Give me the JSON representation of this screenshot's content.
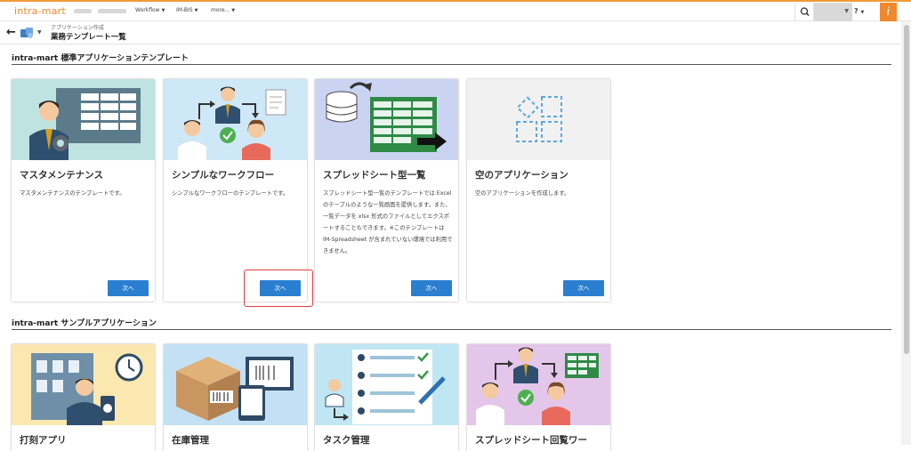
{
  "header": {
    "logo": "intra-mart",
    "nav": [
      "Workflow",
      "IM-BIS",
      "more..."
    ],
    "help_label": "?",
    "info_label": "i"
  },
  "breadcrumb": {
    "parent": "アプリケーション作成",
    "title": "業務テンプレート一覧"
  },
  "sections": [
    {
      "title": "intra-mart 標準アプリケーションテンプレート",
      "cards": [
        {
          "title": "マスタメンテナンス",
          "desc": "マスタメンテナンスのテンプレートです。",
          "button": "次へ",
          "image": "master-maintenance-illustration"
        },
        {
          "title": "シンプルなワークフロー",
          "desc": "シンプルなワークフローのテンプレートです。",
          "button": "次へ",
          "image": "simple-workflow-illustration"
        },
        {
          "title": "スプレッドシート型一覧",
          "desc": "スプレッドシート型一覧のテンプレートでは Excel のテーブルのような一覧画面を提供します。また、一覧データを xlsx 形式のファイルとしてエクスポートすることもできます。※このテンプレートは IM-Spreadsheet が含まれていない環境では利用できません。",
          "button": "次へ",
          "image": "spreadsheet-list-illustration"
        },
        {
          "title": "空のアプリケーション",
          "desc": "空のアプリケーションを作成します。",
          "button": "次へ",
          "image": "empty-application-illustration"
        }
      ]
    },
    {
      "title": "intra-mart サンプルアプリケーション",
      "cards": [
        {
          "title": "打刻アプリ",
          "image": "timestamp-app-illustration"
        },
        {
          "title": "在庫管理",
          "image": "inventory-illustration"
        },
        {
          "title": "タスク管理",
          "image": "task-management-illustration"
        },
        {
          "title": "スプレッドシート回覧ワー",
          "image": "spreadsheet-circulation-illustration"
        }
      ]
    }
  ],
  "colors": {
    "accent": "#f0892e",
    "button": "#2a7fd0",
    "highlight": "#e04040",
    "card1_bg": "#bfe3e0",
    "card2_bg": "#cfe8f7",
    "card3_bg": "#cbd3f2",
    "card4_bg": "#f1f1f1",
    "card5_bg": "#fbe7b0",
    "card6_bg": "#c4e0f4",
    "card7_bg": "#bfe6f2",
    "card8_bg": "#e4c6ea"
  }
}
